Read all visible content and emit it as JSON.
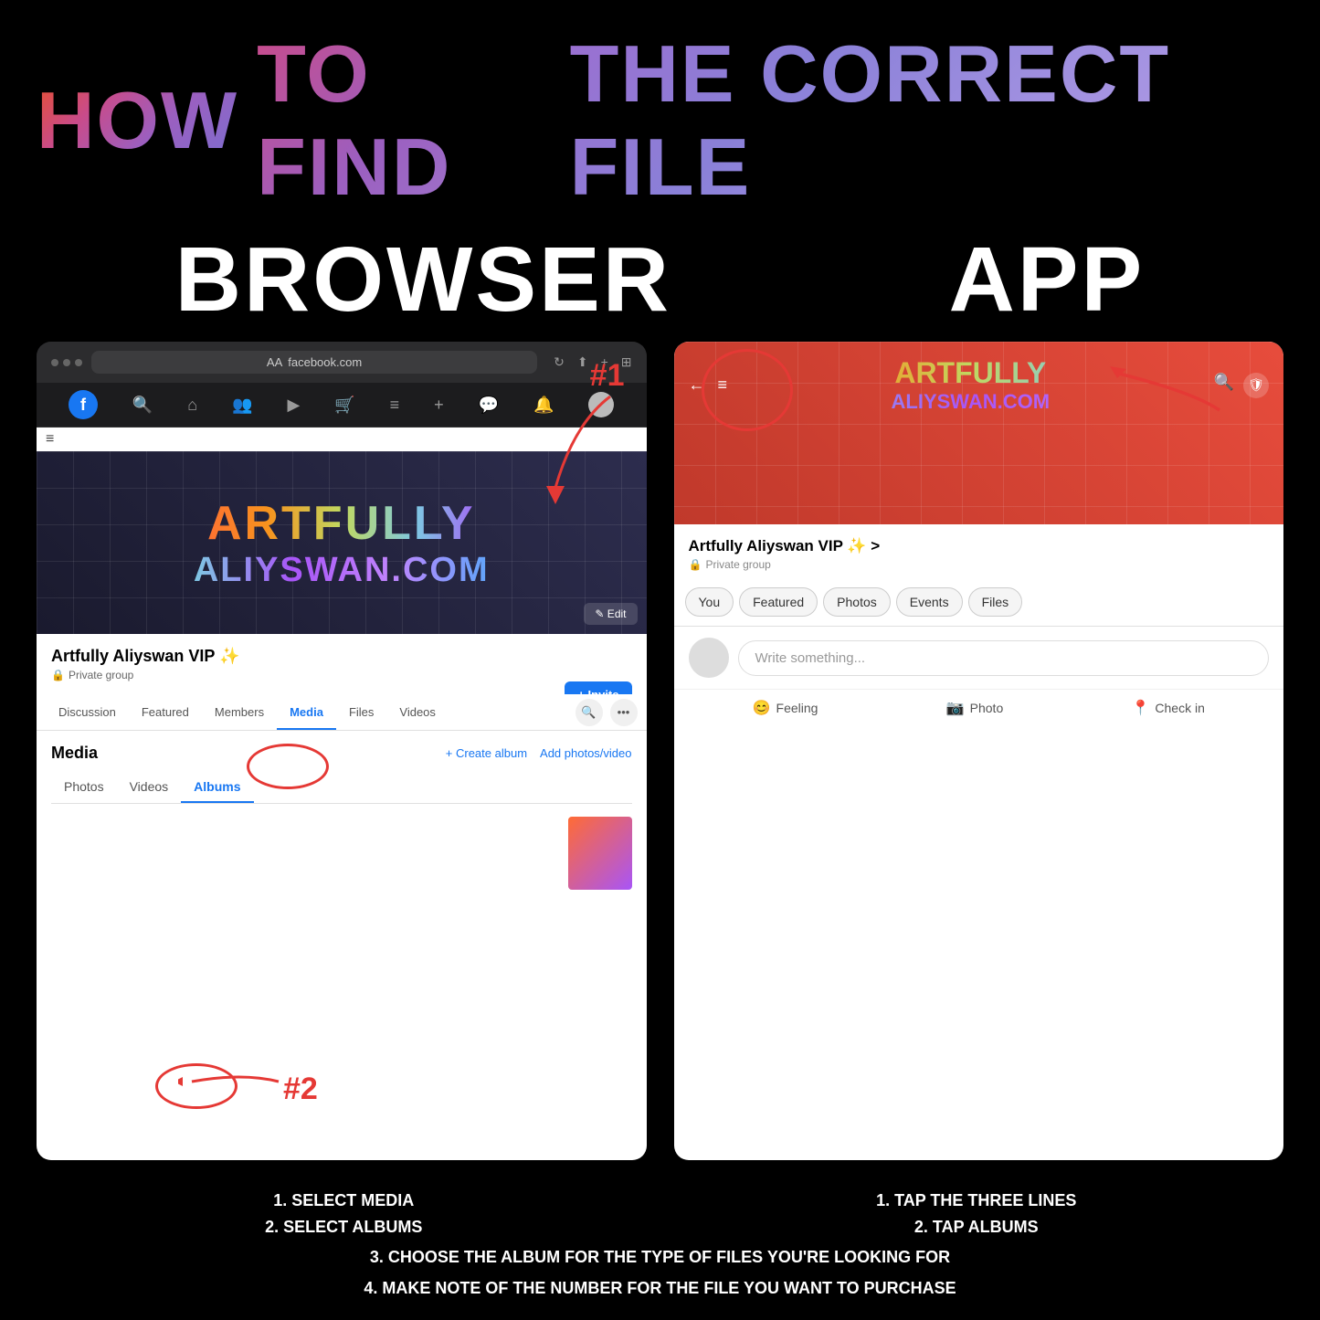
{
  "title": {
    "how": "HOW",
    "to_find": "TO FIND",
    "the_correct_file": "THE CORRECT FILE"
  },
  "sections": {
    "browser_label": "BROWSER",
    "app_label": "APP"
  },
  "browser": {
    "url": "facebook.com",
    "url_label": "AA",
    "group_name": "Artfully Aliyswan VIP ✨",
    "group_privacy": "Private group",
    "invite_btn": "+ Invite",
    "edit_btn": "✎ Edit",
    "tabs": [
      "Discussion",
      "Featured",
      "Members",
      "Media",
      "Files",
      "Videos"
    ],
    "active_tab": "Media",
    "media_title": "Media",
    "create_album": "+ Create album",
    "add_photos": "Add photos/video",
    "media_tabs": [
      "Photos",
      "Videos",
      "Albums"
    ],
    "active_media_tab": "Albums",
    "artfully_line1": "ARTFULLY",
    "artfully_line2": "ALIYSWAN.COM",
    "annotation_1": "#1",
    "annotation_2": "#2"
  },
  "app": {
    "group_name": "Artfully Aliyswan VIP ✨ >",
    "group_privacy": "Private group",
    "artfully_line1": "ARTFULLY",
    "artfully_line2": "ALIYSWAN.COM",
    "tabs": [
      "You",
      "Featured",
      "Photos",
      "Events",
      "Files"
    ],
    "write_placeholder": "Write something...",
    "actions": {
      "feeling": "Feeling",
      "photo": "Photo",
      "checkin": "Check in"
    }
  },
  "instructions": {
    "browser": {
      "line1": "1. SELECT MEDIA",
      "line2": "2. SELECT ALBUMS"
    },
    "app": {
      "line1": "1. TAP THE THREE LINES",
      "line2": "2. TAP ALBUMS"
    },
    "shared_line1": "3. CHOOSE THE ALBUM FOR THE TYPE OF FILES YOU'RE LOOKING FOR",
    "shared_line2": "4. MAKE NOTE OF THE NUMBER FOR THE FILE YOU WANT TO PURCHASE"
  }
}
